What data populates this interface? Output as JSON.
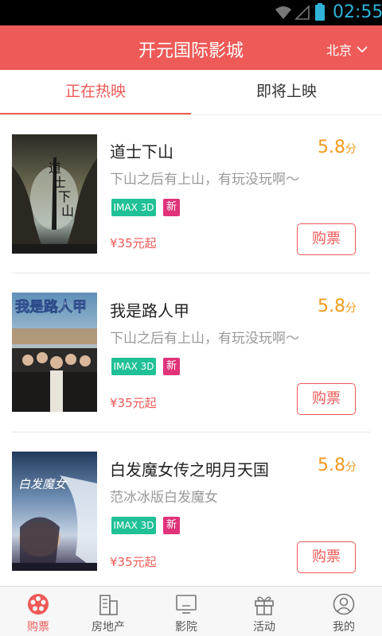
{
  "status_bar": {
    "time": "02:55"
  },
  "header": {
    "title": "开元国际影城",
    "city": "北京"
  },
  "tabs": [
    {
      "label": "正在热映",
      "active": true
    },
    {
      "label": "即将上映",
      "active": false
    }
  ],
  "movies": [
    {
      "name": "道士下山",
      "rating": "5.8",
      "rating_unit": "分",
      "desc": "下山之后有上山，有玩没玩啊～",
      "tag_format": "IMAX 3D",
      "tag_new": "新",
      "price": "¥35元起",
      "buy_label": "购票"
    },
    {
      "name": "我是路人甲",
      "rating": "5.8",
      "rating_unit": "分",
      "desc": "下山之后有上山，有玩没玩啊～",
      "tag_format": "IMAX 3D",
      "tag_new": "新",
      "price": "¥35元起",
      "buy_label": "购票"
    },
    {
      "name": "白发魔女传之明月天国",
      "rating": "5.8",
      "rating_unit": "分",
      "desc": "范冰冰版白发魔女",
      "tag_format": "IMAX 3D",
      "tag_new": "新",
      "price": "¥35元起",
      "buy_label": "购票"
    }
  ],
  "poster_text": {
    "p2": "我是路人甲"
  },
  "bottom_nav": [
    {
      "label": "购票",
      "icon": "film-reel-icon",
      "active": true
    },
    {
      "label": "房地产",
      "icon": "building-icon",
      "active": false
    },
    {
      "label": "影院",
      "icon": "screen-icon",
      "active": false
    },
    {
      "label": "活动",
      "icon": "gift-icon",
      "active": false
    },
    {
      "label": "我的",
      "icon": "user-icon",
      "active": false
    }
  ],
  "colors": {
    "accent": "#ee5a57",
    "rating": "#f29a1f",
    "imax_badge": "#21c197",
    "new_badge": "#e0337a",
    "time": "#2fb3d9"
  }
}
